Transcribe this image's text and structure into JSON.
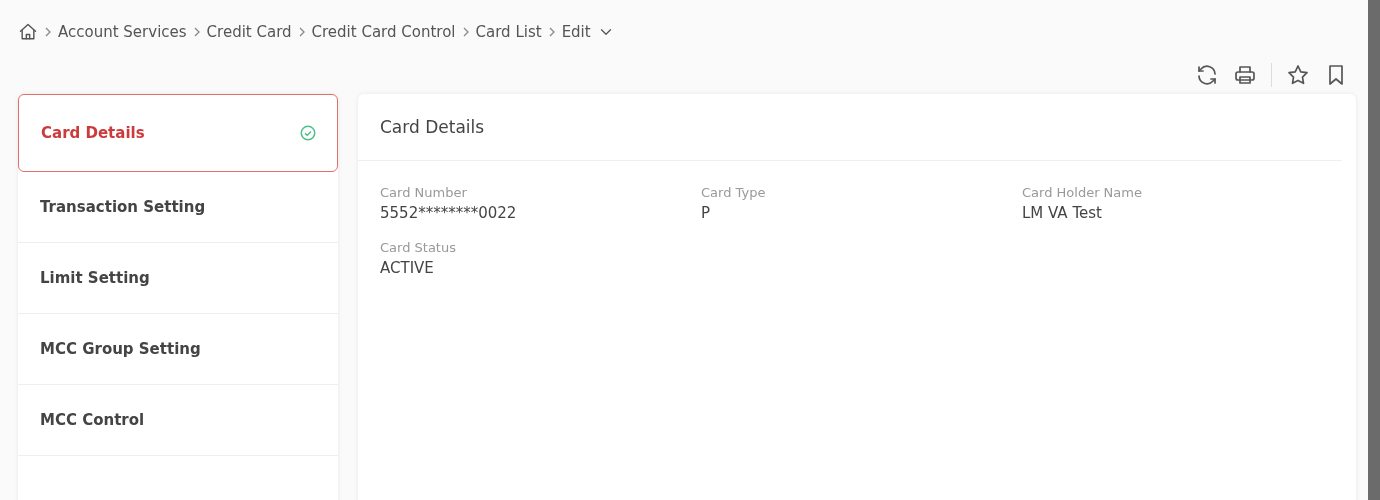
{
  "breadcrumb": {
    "items": [
      "Account Services",
      "Credit Card",
      "Credit Card Control",
      "Card List",
      "Edit"
    ]
  },
  "sidebar": {
    "items": [
      {
        "label": "Card Details",
        "selected": true,
        "done": true
      },
      {
        "label": "Transaction Setting",
        "selected": false,
        "done": false
      },
      {
        "label": "Limit Setting",
        "selected": false,
        "done": false
      },
      {
        "label": "MCC Group Setting",
        "selected": false,
        "done": false
      },
      {
        "label": "MCC Control",
        "selected": false,
        "done": false
      }
    ]
  },
  "panel": {
    "title": "Card Details",
    "fields": [
      {
        "label": "Card Number",
        "value": "5552********0022"
      },
      {
        "label": "Card Type",
        "value": "P"
      },
      {
        "label": "Card Holder Name",
        "value": "LM VA Test"
      },
      {
        "label": "Card Status",
        "value": "ACTIVE"
      }
    ]
  }
}
